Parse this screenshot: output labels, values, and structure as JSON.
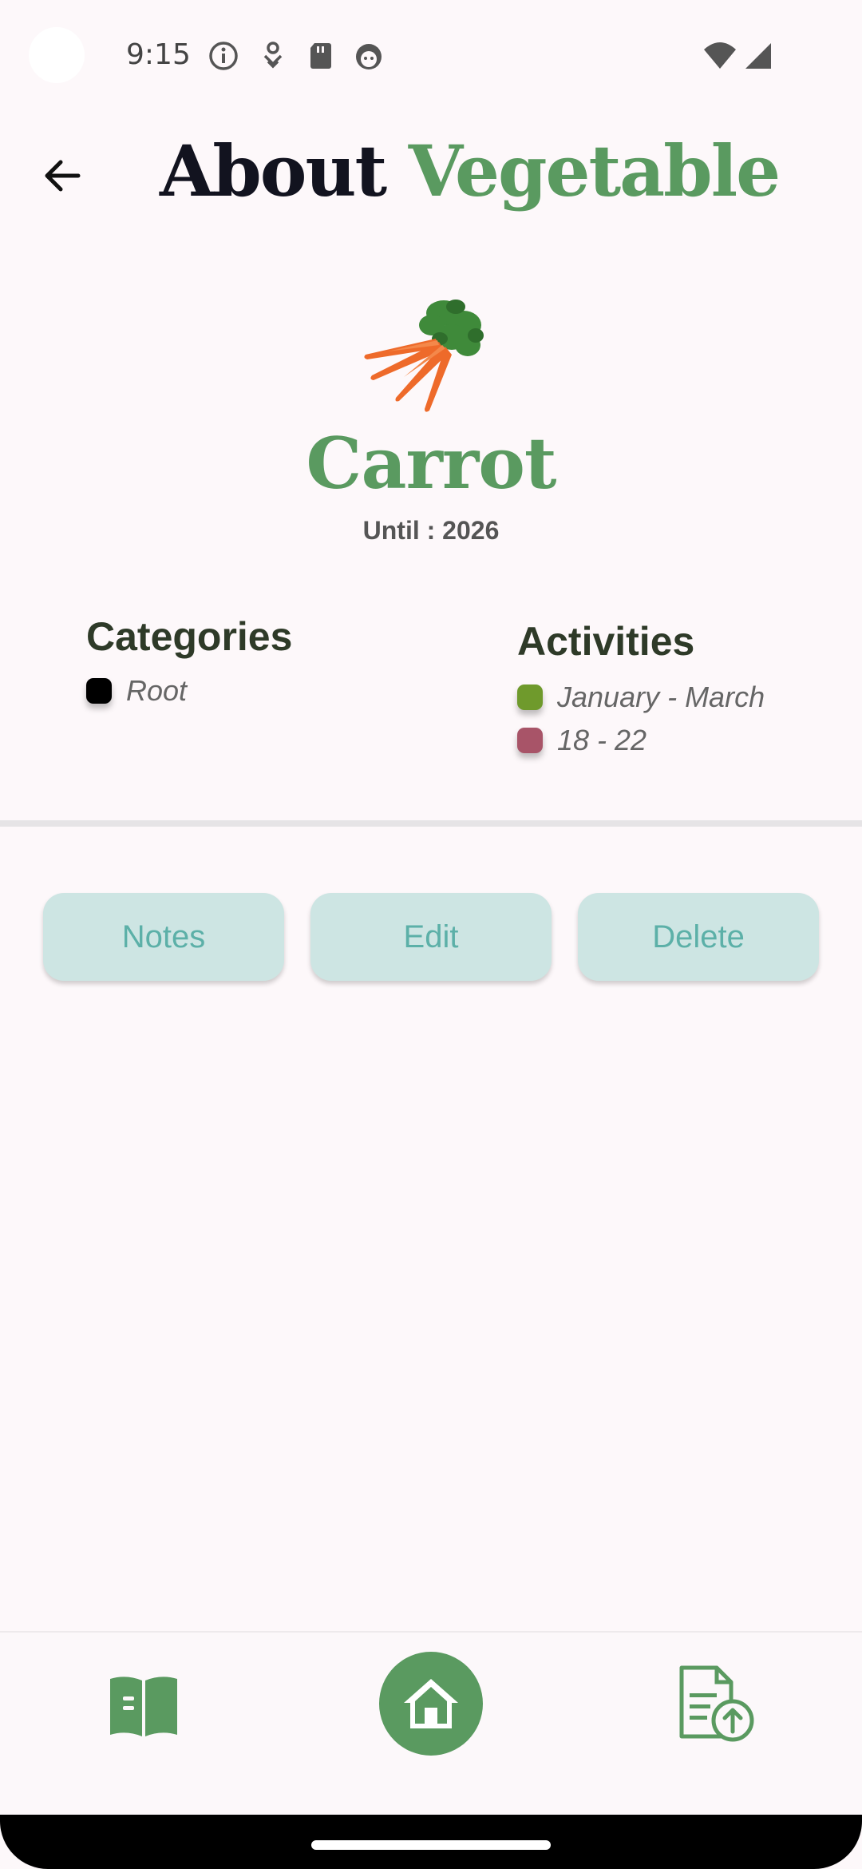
{
  "status_bar": {
    "time": "9:15",
    "icons": [
      "info-icon",
      "download-icon",
      "sd-card-icon",
      "face-icon",
      "wifi-icon",
      "signal-icon"
    ]
  },
  "header": {
    "title_part1": "About",
    "title_part2": "Vegetable",
    "back_icon": "arrow-back-icon"
  },
  "vegetable": {
    "image": "carrot-image",
    "name": "Carrot",
    "until": "Until : 2026"
  },
  "categories": {
    "title": "Categories",
    "items": [
      {
        "label": "Root",
        "color": "#000000"
      }
    ]
  },
  "activities": {
    "title": "Activities",
    "items": [
      {
        "label": "January - March",
        "color": "#6f9a2c"
      },
      {
        "label": "18 - 22",
        "color": "#a85468"
      }
    ]
  },
  "actions": {
    "notes": "Notes",
    "edit": "Edit",
    "delete": "Delete"
  },
  "bottom_nav": {
    "left_icon": "book-icon",
    "center_icon": "home-icon",
    "right_icon": "document-upload-icon"
  },
  "colors": {
    "accent_green": "#5a9a60",
    "button_bg": "#cde5e3",
    "button_text": "#5cb0a8",
    "background": "#fdf8fa"
  }
}
